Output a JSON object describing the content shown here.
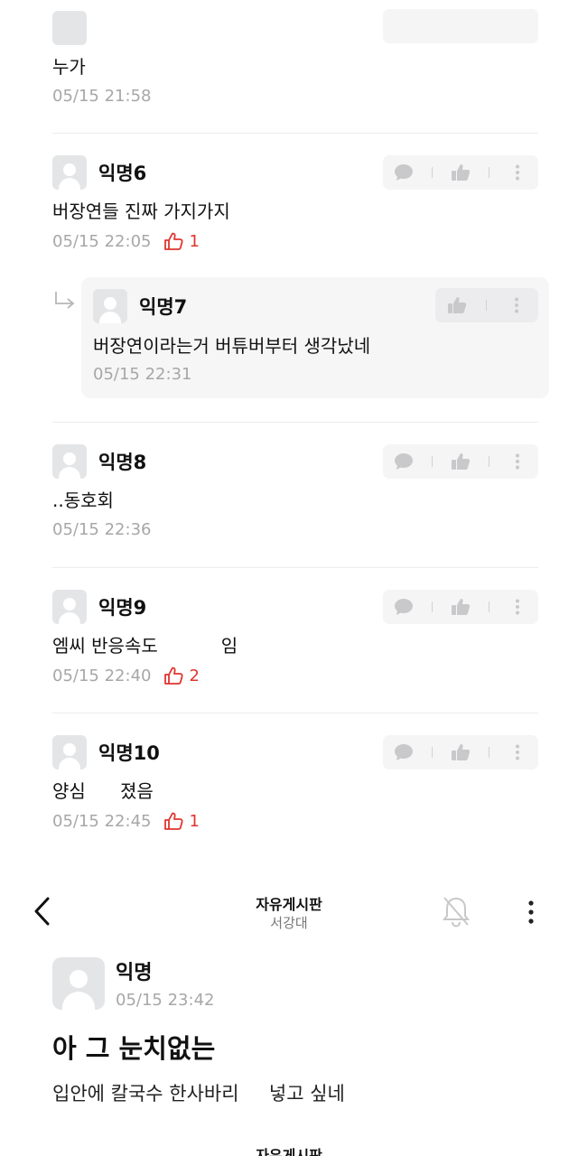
{
  "comments_top": {
    "c0": {
      "text": "누가",
      "time": "05/15 21:58"
    },
    "c1": {
      "nick": "익명6",
      "text": "버장연들 진짜 가지가지",
      "time": "05/15 22:05",
      "likes": "1"
    },
    "c1_reply": {
      "nick": "익명7",
      "text": "버장연이라는거 버튜버부터 생각났네",
      "time": "05/15 22:31"
    },
    "c2": {
      "nick": "익명8",
      "text": "..동호회",
      "time": "05/15 22:36"
    },
    "c3": {
      "nick": "익명9",
      "text": "엠씨 반응속도           임",
      "time": "05/15 22:40",
      "likes": "2"
    },
    "c4": {
      "nick": "익명10",
      "text": "양심      졌음",
      "time": "05/15 22:45",
      "likes": "1"
    }
  },
  "icons": {
    "comment": "speech-bubble-icon",
    "like": "thumb-up-icon",
    "more": "vertical-dots-icon",
    "reply": "reply-arrow-icon",
    "like_count": "thumb-outline-icon",
    "back": "chevron-left-icon",
    "notify": "bell-off-icon"
  },
  "colors": {
    "accent_red": "#e0342f",
    "muted": "#a7a7a7"
  },
  "header": {
    "title": "자유게시판",
    "subtitle": "서강대"
  },
  "post": {
    "nick": "익명",
    "time": "05/15 23:42",
    "title": "아 그 눈치없는",
    "body": "입안에 칼국수 한사바리     넣고 싶네"
  },
  "peek": {
    "title": "자유게시판"
  }
}
